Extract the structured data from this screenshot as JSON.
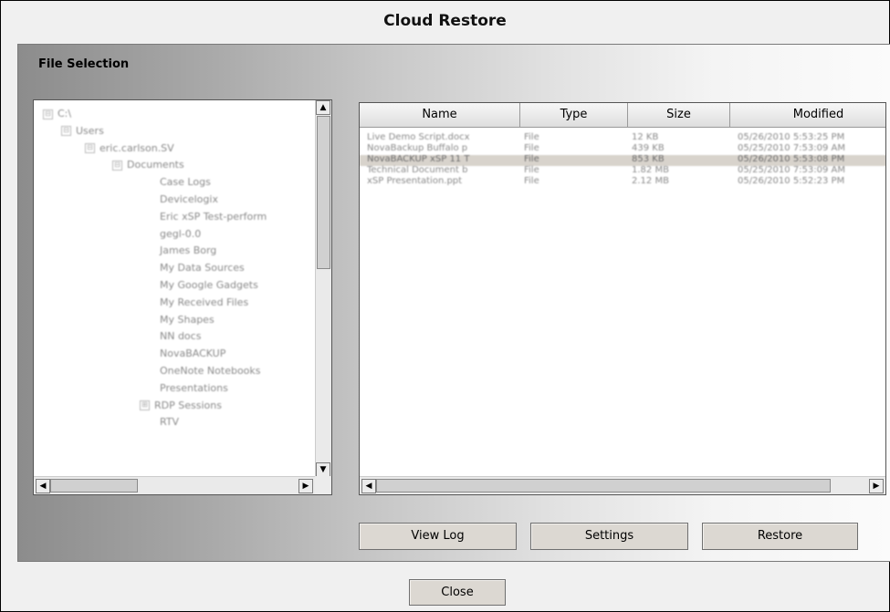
{
  "window": {
    "title": "Cloud Restore"
  },
  "panel": {
    "title": "File Selection"
  },
  "tree": {
    "items": [
      {
        "label": "C:\\",
        "expander": "⊟"
      },
      {
        "label": "Users",
        "expander": "⊟"
      },
      {
        "label": "eric.carlson.SV",
        "expander": "⊟"
      },
      {
        "label": "Documents",
        "expander": "⊟"
      },
      {
        "label": "Case Logs",
        "expander": ""
      },
      {
        "label": "Devicelogix",
        "expander": ""
      },
      {
        "label": "Eric xSP Test-perform",
        "expander": ""
      },
      {
        "label": "gegl-0.0",
        "expander": ""
      },
      {
        "label": "James Borg",
        "expander": ""
      },
      {
        "label": "My Data Sources",
        "expander": ""
      },
      {
        "label": "My Google Gadgets",
        "expander": ""
      },
      {
        "label": "My Received Files",
        "expander": ""
      },
      {
        "label": "My Shapes",
        "expander": ""
      },
      {
        "label": "NN docs",
        "expander": ""
      },
      {
        "label": "NovaBACKUP",
        "expander": ""
      },
      {
        "label": "OneNote Notebooks",
        "expander": ""
      },
      {
        "label": "Presentations",
        "expander": ""
      },
      {
        "label": "RDP Sessions",
        "expander": "⊞"
      },
      {
        "label": "RTV",
        "expander": ""
      }
    ]
  },
  "file_list": {
    "columns": [
      "Name",
      "Type",
      "Size",
      "Modified"
    ],
    "rows": [
      {
        "name": "Live Demo Script.docx",
        "type": "File",
        "size": "12 KB",
        "modified": "05/26/2010 5:53:25 PM"
      },
      {
        "name": "NovaBackup Buffalo p",
        "type": "File",
        "size": "439 KB",
        "modified": "05/25/2010 7:53:09 AM"
      },
      {
        "name": "NovaBACKUP xSP 11 T",
        "type": "File",
        "size": "853 KB",
        "modified": "05/26/2010 5:53:08 PM"
      },
      {
        "name": "Technical Document b",
        "type": "File",
        "size": "1.82 MB",
        "modified": "05/25/2010 7:53:09 AM"
      },
      {
        "name": "xSP Presentation.ppt",
        "type": "File",
        "size": "2.12 MB",
        "modified": "05/26/2010 5:52:23 PM"
      }
    ],
    "selected_index": 2
  },
  "buttons": {
    "view_log": "View Log",
    "settings": "Settings",
    "restore": "Restore",
    "close": "Close"
  },
  "icons": {
    "scroll_up": "▲",
    "scroll_down": "▼",
    "scroll_left": "◀",
    "scroll_right": "▶"
  }
}
